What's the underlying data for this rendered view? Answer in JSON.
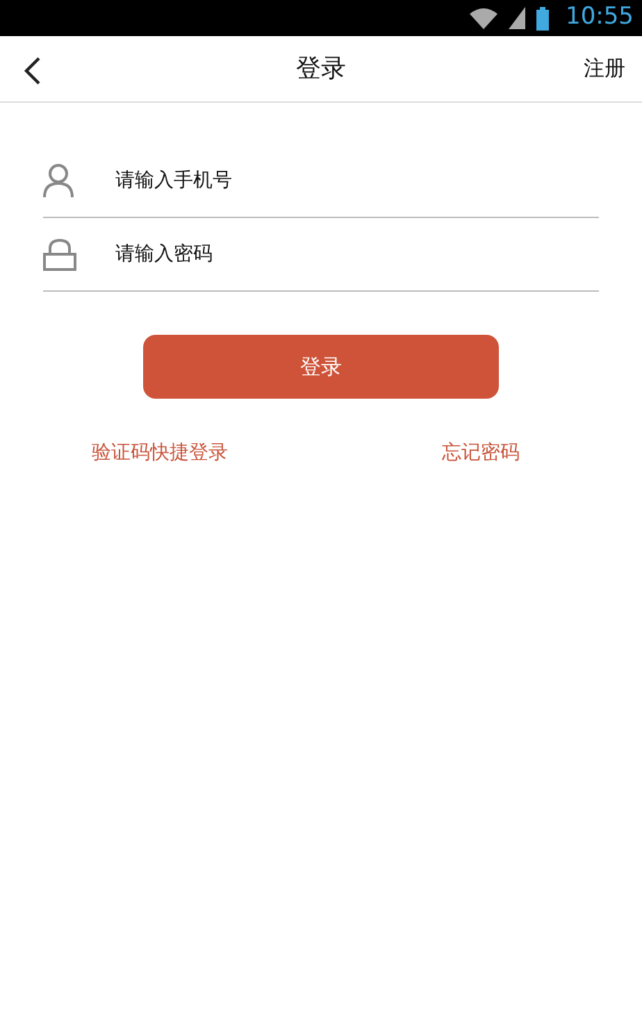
{
  "status_bar": {
    "time": "10:55"
  },
  "app_bar": {
    "title": "登录",
    "action": "注册"
  },
  "fields": [
    {
      "kind": "phone",
      "placeholder": "请输入手机号"
    },
    {
      "kind": "password",
      "placeholder": "请输入密码"
    }
  ],
  "login_button": "登录",
  "links": [
    "验证码快捷登录",
    "忘记密码"
  ]
}
